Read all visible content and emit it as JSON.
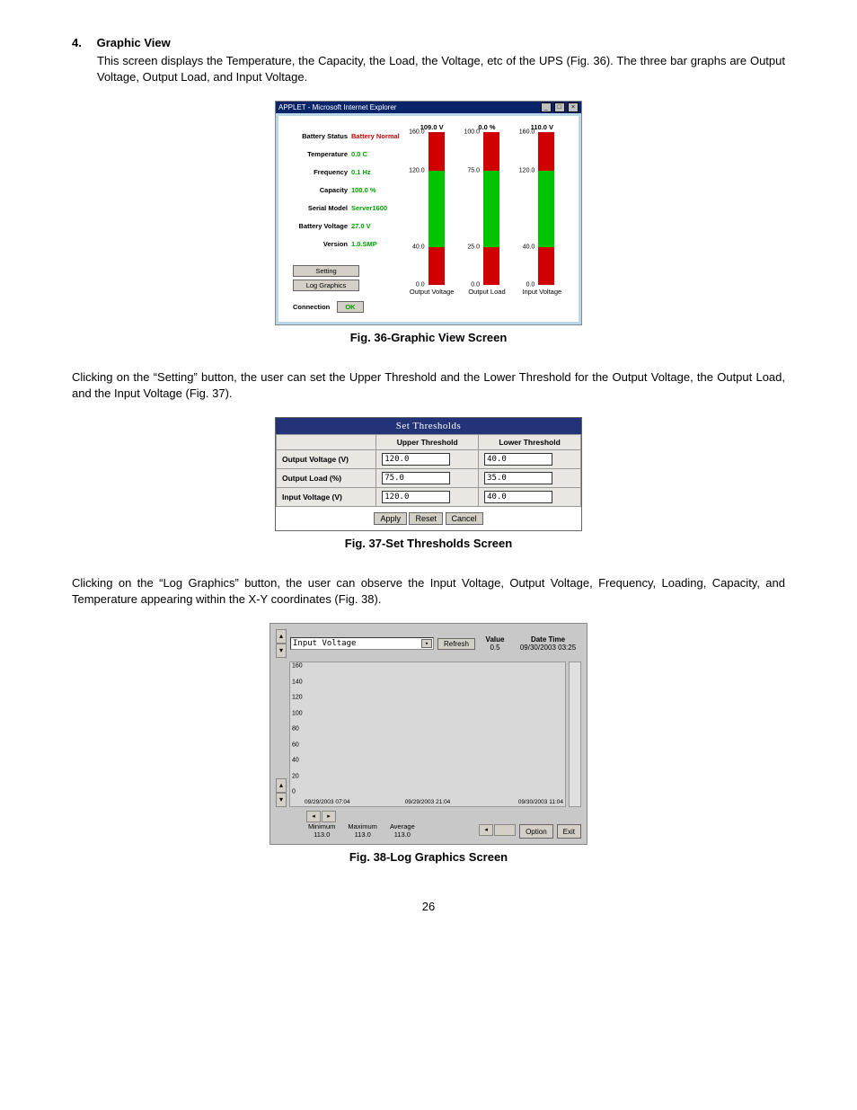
{
  "section": {
    "num": "4.",
    "title": "Graphic View"
  },
  "para1": "This screen displays the Temperature, the Capacity, the Load, the Voltage, etc of the UPS (Fig. 36).  The three bar graphs are Output Voltage, Output Load, and Input Voltage.",
  "fig36": {
    "caption": "Fig. 36-Graphic View Screen",
    "window_title": "APPLET - Microsoft Internet Explorer",
    "labels": {
      "battery_status": "Battery Status",
      "temperature": "Temperature",
      "frequency": "Frequency",
      "capacity": "Capacity",
      "serial_model": "Serial Model",
      "battery_voltage": "Battery Voltage",
      "version": "Version",
      "connection": "Connection"
    },
    "values": {
      "battery_status": "Battery Normal",
      "temperature": "0.0 C",
      "frequency": "0.1 Hz",
      "capacity": "100.0 %",
      "serial_model": "Server1600",
      "battery_voltage": "27.0 V",
      "version": "1.0.SMP",
      "connection": "OK"
    },
    "buttons": {
      "setting": "Setting",
      "log": "Log Graphics"
    },
    "bars": [
      {
        "title": "109.0 V",
        "ticks": [
          "160.0",
          "120.0",
          "40.0",
          "0.0"
        ],
        "caption": "Output Voltage",
        "fills": [
          {
            "from": 0,
            "to": 25,
            "color": "#d00000"
          },
          {
            "from": 25,
            "to": 75,
            "color": "#00c400"
          },
          {
            "from": 75,
            "to": 100,
            "color": "#d00000"
          }
        ]
      },
      {
        "title": "0.0 %",
        "ticks": [
          "100.0",
          "75.0",
          "25.0",
          "0.0"
        ],
        "caption": "Output Load",
        "fills": [
          {
            "from": 0,
            "to": 25,
            "color": "#d00000"
          },
          {
            "from": 25,
            "to": 75,
            "color": "#00c400"
          },
          {
            "from": 75,
            "to": 100,
            "color": "#d00000"
          }
        ]
      },
      {
        "title": "110.0 V",
        "ticks": [
          "160.0",
          "120.0",
          "40.0",
          "0.0"
        ],
        "caption": "Input Voltage",
        "fills": [
          {
            "from": 0,
            "to": 25,
            "color": "#d00000"
          },
          {
            "from": 25,
            "to": 75,
            "color": "#00c400"
          },
          {
            "from": 75,
            "to": 100,
            "color": "#d00000"
          }
        ]
      }
    ]
  },
  "para2": "Clicking on the “Setting” button, the user can set the Upper Threshold and the Lower Threshold for the Output Voltage, the Output Load, and the Input Voltage (Fig. 37).",
  "fig37": {
    "caption": "Fig. 37-Set Thresholds Screen",
    "title": "Set Thresholds",
    "col_upper": "Upper Threshold",
    "col_lower": "Lower Threshold",
    "rows": [
      {
        "label": "Output Voltage (V)",
        "upper": "120.0",
        "lower": "40.0"
      },
      {
        "label": "Output Load (%)",
        "upper": "75.0",
        "lower": "35.0"
      },
      {
        "label": "Input Voltage (V)",
        "upper": "120.0",
        "lower": "40.0"
      }
    ],
    "buttons": {
      "apply": "Apply",
      "reset": "Reset",
      "cancel": "Cancel"
    }
  },
  "para3": "Clicking on the “Log Graphics” button, the user can observe the Input Voltage, Output Voltage, Frequency, Loading, Capacity, and Temperature appearing within the X-Y coordinates (Fig. 38).",
  "fig38": {
    "caption": "Fig. 38-Log Graphics Screen",
    "select": "Input Voltage",
    "refresh": "Refresh",
    "value_label": "Value",
    "value": "0.5",
    "datetime_label": "Date Time",
    "datetime": "09/30/2003 03:25",
    "yticks": [
      "160",
      "140",
      "120",
      "100",
      "80",
      "60",
      "40",
      "20",
      "0"
    ],
    "x_left": "09/29/2003 07:04",
    "x_mid": "09/29/2003 21:04",
    "x_right": "09/30/2003 11:04",
    "stats": {
      "min_label": "Minimum",
      "min": "113.0",
      "max_label": "Maximum",
      "max": "113.0",
      "avg_label": "Average",
      "avg": "113.0"
    },
    "buttons": {
      "option": "Option",
      "exit": "Exit"
    }
  },
  "pagenum": "26",
  "chart_data": [
    {
      "type": "bar",
      "title": "UPS Live Readings (Fig. 36)",
      "categories": [
        "Output Voltage (V)",
        "Output Load (%)",
        "Input Voltage (V)"
      ],
      "values": [
        109.0,
        0.0,
        110.0
      ],
      "thresholds": {
        "Output Voltage (V)": {
          "upper": 120.0,
          "lower": 40.0,
          "ylim": [
            0,
            160
          ]
        },
        "Output Load (%)": {
          "upper": 75.0,
          "lower": 25.0,
          "ylim": [
            0,
            100
          ]
        },
        "Input Voltage (V)": {
          "upper": 120.0,
          "lower": 40.0,
          "ylim": [
            0,
            160
          ]
        }
      }
    },
    {
      "type": "line",
      "title": "Input Voltage log (Fig. 38)",
      "ylabel": "Input Voltage",
      "ylim": [
        0,
        160
      ],
      "x_range": [
        "09/29/2003 07:04",
        "09/30/2003 11:04"
      ],
      "series": [
        {
          "name": "Input Voltage",
          "min": 113.0,
          "max": 113.0,
          "avg": 113.0,
          "latest": 0.5
        }
      ]
    }
  ]
}
